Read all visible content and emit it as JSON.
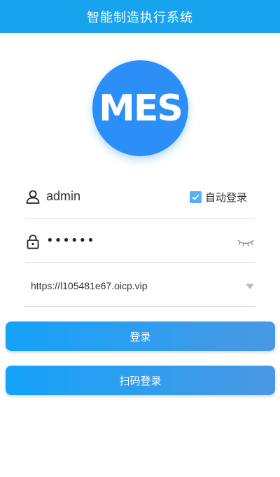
{
  "header": {
    "title": "智能制造执行系统"
  },
  "logo": {
    "text": "MES"
  },
  "login_form": {
    "username": "admin",
    "password_masked": "••••••",
    "auto_login": {
      "label": "自动登录",
      "checked": true
    },
    "server_url": "https://l105481e67.oicp.vip"
  },
  "buttons": {
    "login_label": "登录",
    "scan_login_label": "扫码登录"
  },
  "icons": {
    "user": "user-icon",
    "lock": "lock-icon",
    "eye": "eye-closed-icon",
    "dropdown": "chevron-down-icon",
    "check": "check-icon"
  },
  "colors": {
    "header": "#18a3ee",
    "logo": "#2b8ff7",
    "button_start": "#14a2f9",
    "button_end": "#4a98e3",
    "checkbox": "#5aaef5"
  }
}
